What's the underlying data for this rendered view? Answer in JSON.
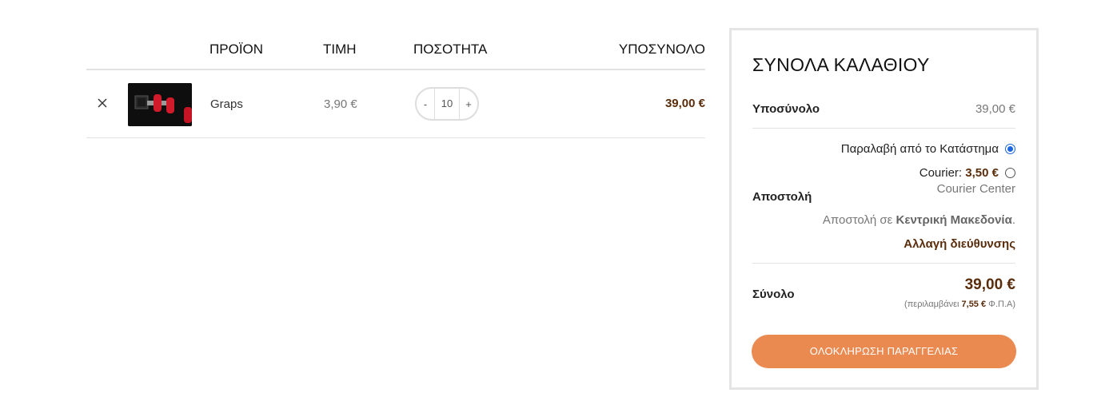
{
  "cart": {
    "headers": {
      "product": "ΠΡΟΪΟΝ",
      "price": "ΤΙΜΗ",
      "quantity": "ΠΟΣΟΤΗΤΑ",
      "subtotal": "ΥΠΟΣΥΝΟΛΟ"
    },
    "items": [
      {
        "name": "Graps",
        "price": "3,90 €",
        "quantity": "10",
        "qty_minus": "-",
        "qty_plus": "+",
        "subtotal": "39,00 €"
      }
    ]
  },
  "totals": {
    "title": "ΣΥΝΟΛΑ ΚΑΛΑΘΙΟΥ",
    "subtotal_label": "Υποσύνολο",
    "subtotal_value": "39,00 €",
    "shipping_label": "Αποστολή",
    "shipping_options": [
      {
        "label": "Παραλαβή από το Κατάστημα",
        "selected": true
      },
      {
        "label": "Courier: ",
        "price": "3,50 €",
        "selected": false
      }
    ],
    "courier_name": "Courier Center",
    "shipping_to_prefix": "Αποστολή σε ",
    "shipping_to_region": "Κεντρική Μακεδονία",
    "shipping_to_suffix": ".",
    "change_address": "Αλλαγή διεύθυνσης",
    "total_label": "Σύνολο",
    "total_value": "39,00 €",
    "tax_prefix": "(περιλαμβάνει ",
    "tax_amount": "7,55 €",
    "tax_suffix": " Φ.Π.Α)",
    "checkout_button": "ΟΛΟΚΛΗΡΩΣΗ ΠΑΡΑΓΓΕΛΙΑΣ"
  },
  "colors": {
    "accent": "#eb8a50",
    "price_brown": "#5a2d0c",
    "radio_blue": "#1a66e0"
  },
  "icons": {
    "remove": "close-icon"
  }
}
